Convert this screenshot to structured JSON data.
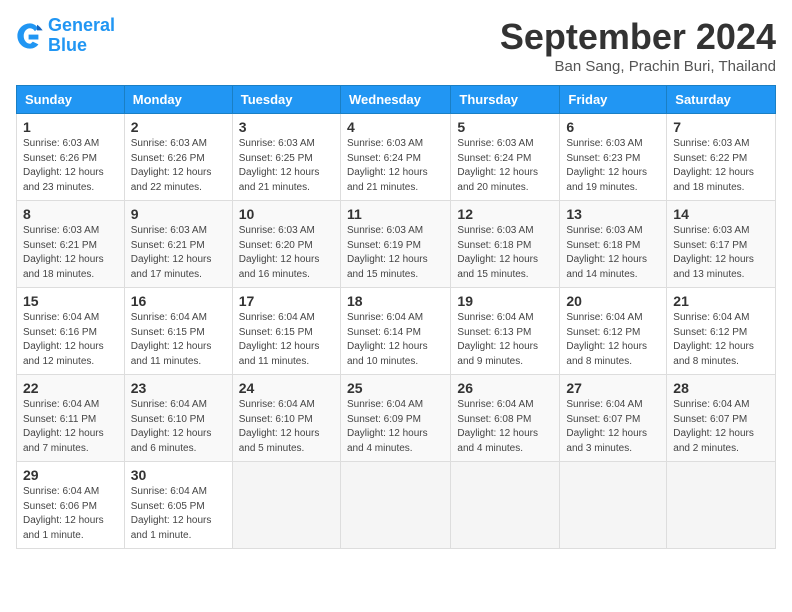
{
  "header": {
    "logo_general": "General",
    "logo_blue": "Blue",
    "month_year": "September 2024",
    "location": "Ban Sang, Prachin Buri, Thailand"
  },
  "weekdays": [
    "Sunday",
    "Monday",
    "Tuesday",
    "Wednesday",
    "Thursday",
    "Friday",
    "Saturday"
  ],
  "weeks": [
    [
      {
        "day": "1",
        "info": "Sunrise: 6:03 AM\nSunset: 6:26 PM\nDaylight: 12 hours\nand 23 minutes."
      },
      {
        "day": "2",
        "info": "Sunrise: 6:03 AM\nSunset: 6:26 PM\nDaylight: 12 hours\nand 22 minutes."
      },
      {
        "day": "3",
        "info": "Sunrise: 6:03 AM\nSunset: 6:25 PM\nDaylight: 12 hours\nand 21 minutes."
      },
      {
        "day": "4",
        "info": "Sunrise: 6:03 AM\nSunset: 6:24 PM\nDaylight: 12 hours\nand 21 minutes."
      },
      {
        "day": "5",
        "info": "Sunrise: 6:03 AM\nSunset: 6:24 PM\nDaylight: 12 hours\nand 20 minutes."
      },
      {
        "day": "6",
        "info": "Sunrise: 6:03 AM\nSunset: 6:23 PM\nDaylight: 12 hours\nand 19 minutes."
      },
      {
        "day": "7",
        "info": "Sunrise: 6:03 AM\nSunset: 6:22 PM\nDaylight: 12 hours\nand 18 minutes."
      }
    ],
    [
      {
        "day": "8",
        "info": "Sunrise: 6:03 AM\nSunset: 6:21 PM\nDaylight: 12 hours\nand 18 minutes."
      },
      {
        "day": "9",
        "info": "Sunrise: 6:03 AM\nSunset: 6:21 PM\nDaylight: 12 hours\nand 17 minutes."
      },
      {
        "day": "10",
        "info": "Sunrise: 6:03 AM\nSunset: 6:20 PM\nDaylight: 12 hours\nand 16 minutes."
      },
      {
        "day": "11",
        "info": "Sunrise: 6:03 AM\nSunset: 6:19 PM\nDaylight: 12 hours\nand 15 minutes."
      },
      {
        "day": "12",
        "info": "Sunrise: 6:03 AM\nSunset: 6:18 PM\nDaylight: 12 hours\nand 15 minutes."
      },
      {
        "day": "13",
        "info": "Sunrise: 6:03 AM\nSunset: 6:18 PM\nDaylight: 12 hours\nand 14 minutes."
      },
      {
        "day": "14",
        "info": "Sunrise: 6:03 AM\nSunset: 6:17 PM\nDaylight: 12 hours\nand 13 minutes."
      }
    ],
    [
      {
        "day": "15",
        "info": "Sunrise: 6:04 AM\nSunset: 6:16 PM\nDaylight: 12 hours\nand 12 minutes."
      },
      {
        "day": "16",
        "info": "Sunrise: 6:04 AM\nSunset: 6:15 PM\nDaylight: 12 hours\nand 11 minutes."
      },
      {
        "day": "17",
        "info": "Sunrise: 6:04 AM\nSunset: 6:15 PM\nDaylight: 12 hours\nand 11 minutes."
      },
      {
        "day": "18",
        "info": "Sunrise: 6:04 AM\nSunset: 6:14 PM\nDaylight: 12 hours\nand 10 minutes."
      },
      {
        "day": "19",
        "info": "Sunrise: 6:04 AM\nSunset: 6:13 PM\nDaylight: 12 hours\nand 9 minutes."
      },
      {
        "day": "20",
        "info": "Sunrise: 6:04 AM\nSunset: 6:12 PM\nDaylight: 12 hours\nand 8 minutes."
      },
      {
        "day": "21",
        "info": "Sunrise: 6:04 AM\nSunset: 6:12 PM\nDaylight: 12 hours\nand 8 minutes."
      }
    ],
    [
      {
        "day": "22",
        "info": "Sunrise: 6:04 AM\nSunset: 6:11 PM\nDaylight: 12 hours\nand 7 minutes."
      },
      {
        "day": "23",
        "info": "Sunrise: 6:04 AM\nSunset: 6:10 PM\nDaylight: 12 hours\nand 6 minutes."
      },
      {
        "day": "24",
        "info": "Sunrise: 6:04 AM\nSunset: 6:10 PM\nDaylight: 12 hours\nand 5 minutes."
      },
      {
        "day": "25",
        "info": "Sunrise: 6:04 AM\nSunset: 6:09 PM\nDaylight: 12 hours\nand 4 minutes."
      },
      {
        "day": "26",
        "info": "Sunrise: 6:04 AM\nSunset: 6:08 PM\nDaylight: 12 hours\nand 4 minutes."
      },
      {
        "day": "27",
        "info": "Sunrise: 6:04 AM\nSunset: 6:07 PM\nDaylight: 12 hours\nand 3 minutes."
      },
      {
        "day": "28",
        "info": "Sunrise: 6:04 AM\nSunset: 6:07 PM\nDaylight: 12 hours\nand 2 minutes."
      }
    ],
    [
      {
        "day": "29",
        "info": "Sunrise: 6:04 AM\nSunset: 6:06 PM\nDaylight: 12 hours\nand 1 minute."
      },
      {
        "day": "30",
        "info": "Sunrise: 6:04 AM\nSunset: 6:05 PM\nDaylight: 12 hours\nand 1 minute."
      },
      null,
      null,
      null,
      null,
      null
    ]
  ]
}
